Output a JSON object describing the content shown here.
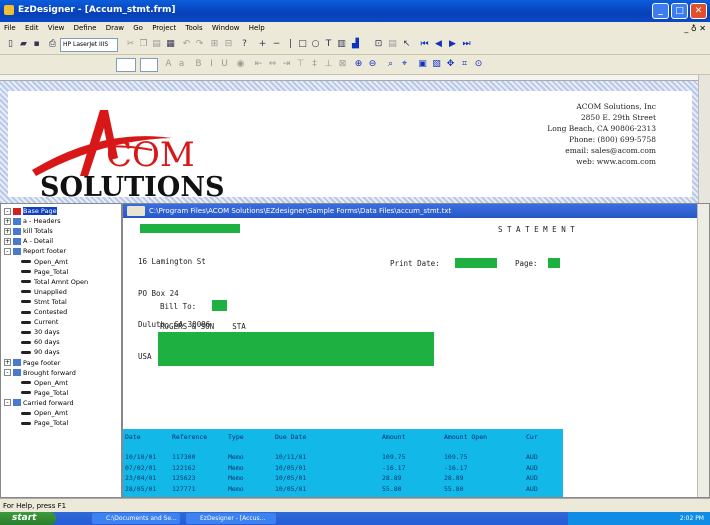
{
  "window": {
    "title": "EzDesigner - [Accum_stmt.frm]",
    "min": "_",
    "max": "□",
    "close": "✕"
  },
  "menu": [
    "File",
    "Edit",
    "View",
    "Define",
    "Draw",
    "Go",
    "Project",
    "Tools",
    "Window",
    "Help"
  ],
  "mdi_controls": "_ ♁ ✕",
  "toolbar": {
    "printer": "HP LaserJet IIIS"
  },
  "company": {
    "lines": [
      "ACOM Solutions, Inc",
      "2850 E. 29th Street",
      "Long Beach, CA 90806-2313",
      "Phone: (800) 699-5758",
      "email: sales@acom.com",
      "web: www.acom.com"
    ],
    "logo_top": "COM",
    "logo_bottom": "SOLUTIONS"
  },
  "tree": [
    {
      "label": "Base Page",
      "level": 0,
      "exp": "-",
      "icon": "red",
      "sel": true
    },
    {
      "label": "a - Headers",
      "level": 0,
      "exp": "+",
      "icon": "blue"
    },
    {
      "label": "kill Totals",
      "level": 0,
      "exp": "+",
      "icon": "blue"
    },
    {
      "label": "A - Detail",
      "level": 0,
      "exp": "+",
      "icon": "blue"
    },
    {
      "label": "Report footer",
      "level": 0,
      "exp": "-",
      "icon": "blue"
    },
    {
      "label": "Open_Amt",
      "level": 1
    },
    {
      "label": "Page_Total",
      "level": 1
    },
    {
      "label": "Total Amnt Open",
      "level": 1
    },
    {
      "label": "Unapplied",
      "level": 1
    },
    {
      "label": "Stmt Total",
      "level": 1
    },
    {
      "label": "Contested",
      "level": 1
    },
    {
      "label": "Current",
      "level": 1
    },
    {
      "label": "30 days",
      "level": 1
    },
    {
      "label": "60 days",
      "level": 1
    },
    {
      "label": "90 days",
      "level": 1
    },
    {
      "label": "Page footer",
      "level": 0,
      "exp": "+",
      "icon": "blue"
    },
    {
      "label": "Brought forward",
      "level": 0,
      "exp": "-",
      "icon": "blue"
    },
    {
      "label": "Open_Amt",
      "level": 1
    },
    {
      "label": "Page_Total",
      "level": 1
    },
    {
      "label": "Carried forward",
      "level": 0,
      "exp": "-",
      "icon": "blue"
    },
    {
      "label": "Open_Amt",
      "level": 1
    },
    {
      "label": "Page_Total",
      "level": 1
    }
  ],
  "doc": {
    "path": "C:\\Program Files\\ACOM Solutions\\EZdesigner\\Sample Forms\\Data Files\\accum_stmt.txt",
    "address": [
      "16 Lamington St",
      "PO Box 24",
      "Duluth, GA 30096",
      "USA"
    ],
    "statement": "S T A T E M E N T",
    "print_date": "Print Date:",
    "page": "Page:",
    "bill_to": "Bill To:",
    "customer": "ROGERS & SON    STA"
  },
  "table": {
    "headers": [
      "Date",
      "Reference",
      "Type",
      "Due Date",
      "Amount",
      "Amount Open",
      "Cur"
    ],
    "rows": [
      [
        "10/10/01",
        "117300",
        "Memo",
        "10/11/01",
        "109.75",
        "109.75",
        "AUD"
      ],
      [
        "07/02/01",
        "122162",
        "Memo",
        "10/05/01",
        "-16.17",
        "-16.17",
        "AUD"
      ],
      [
        "23/04/01",
        "125623",
        "Memo",
        "10/05/01",
        "28.89",
        "28.89",
        "AUD"
      ],
      [
        "28/05/01",
        "127771",
        "Memo",
        "10/05/01",
        "55.80",
        "55.80",
        "AUD"
      ]
    ]
  },
  "status": "For Help, press F1",
  "taskbar": {
    "start": "start",
    "tasks": [
      "C:\\Documents and Se...",
      "EzDesigner - [Accus..."
    ],
    "clock": "2:02 PM"
  }
}
